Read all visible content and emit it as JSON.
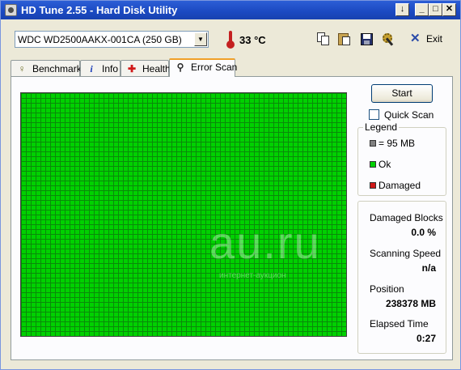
{
  "window": {
    "title": "HD Tune 2.55 - Hard Disk Utility",
    "buttons": {
      "minimize_hint": "↓",
      "minimize": "_",
      "maximize": "□",
      "close": "✕"
    }
  },
  "toolbar": {
    "drive": "WDC WD2500AAKX-001CA (250 GB)",
    "temperature": "33 °C",
    "exit_label": "Exit",
    "icons": [
      "copy-icon",
      "paste-icon",
      "save-icon",
      "options-icon",
      "exit-icon"
    ]
  },
  "tabs": [
    {
      "label": "Benchmark",
      "icon": "benchmark-icon",
      "active": false
    },
    {
      "label": "Info",
      "icon": "info-icon",
      "active": false
    },
    {
      "label": "Health",
      "icon": "health-icon",
      "active": false
    },
    {
      "label": "Error Scan",
      "icon": "scan-icon",
      "active": true
    }
  ],
  "scan": {
    "start_label": "Start",
    "quick_scan_label": "Quick Scan",
    "quick_scan_checked": false,
    "block_color_ok": "#00d100",
    "status": "all blocks ok"
  },
  "legend": {
    "title": "Legend",
    "items": [
      {
        "label": "= 95 MB",
        "color": "#808080"
      },
      {
        "label": "Ok",
        "color": "#00d100"
      },
      {
        "label": "Damaged",
        "color": "#d01818"
      }
    ]
  },
  "stats": {
    "damaged_blocks_label": "Damaged Blocks",
    "damaged_blocks_value": "0.0 %",
    "scanning_speed_label": "Scanning Speed",
    "scanning_speed_value": "n/a",
    "position_label": "Position",
    "position_value": "238378 MB",
    "elapsed_time_label": "Elapsed Time",
    "elapsed_time_value": "0:27"
  },
  "watermark": {
    "text": "au.ru",
    "sub": "интернет-аукцион"
  }
}
